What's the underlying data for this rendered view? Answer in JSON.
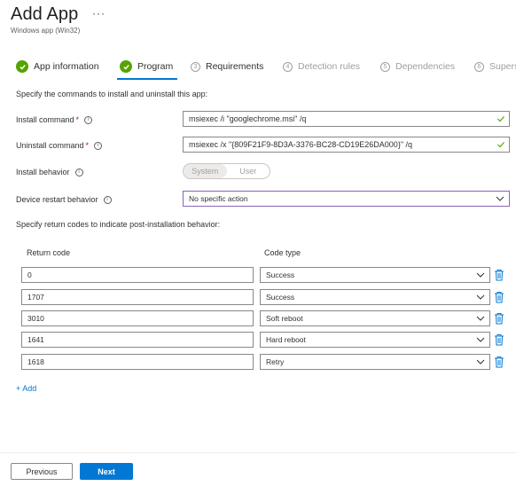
{
  "header": {
    "title": "Add App",
    "more_label": "···",
    "subtitle": "Windows app (Win32)"
  },
  "steps": [
    {
      "num": "",
      "label": "App information",
      "state": "done"
    },
    {
      "num": "",
      "label": "Program",
      "state": "active"
    },
    {
      "num": "3",
      "label": "Requirements",
      "state": "current"
    },
    {
      "num": "4",
      "label": "Detection rules",
      "state": "pending"
    },
    {
      "num": "5",
      "label": "Dependencies",
      "state": "pending"
    },
    {
      "num": "6",
      "label": "Supers",
      "state": "pending"
    }
  ],
  "form": {
    "intro": "Specify the commands to install and uninstall this app:",
    "install_label": "Install command",
    "install_value": "msiexec /i \"googlechrome.msi\" /q",
    "uninstall_label": "Uninstall command",
    "uninstall_value": "msiexec /x \"{809F21F9-8D3A-3376-BC28-CD19E26DA000}\" /q",
    "behavior_label": "Install behavior",
    "behavior_options": [
      "System",
      "User"
    ],
    "behavior_selected": "System",
    "restart_label": "Device restart behavior",
    "restart_value": "No specific action",
    "required_mark": "*",
    "info_glyph": "i"
  },
  "return_codes": {
    "intro": "Specify return codes to indicate post-installation behavior:",
    "col_code": "Return code",
    "col_type": "Code type",
    "rows": [
      {
        "code": "0",
        "type": "Success"
      },
      {
        "code": "1707",
        "type": "Success"
      },
      {
        "code": "3010",
        "type": "Soft reboot"
      },
      {
        "code": "1641",
        "type": "Hard reboot"
      },
      {
        "code": "1618",
        "type": "Retry"
      }
    ],
    "add_label": "+ Add"
  },
  "footer": {
    "previous_label": "Previous",
    "next_label": "Next"
  },
  "colors": {
    "accent": "#0078d4",
    "success": "#57a300",
    "focus_border": "#8764b8"
  }
}
